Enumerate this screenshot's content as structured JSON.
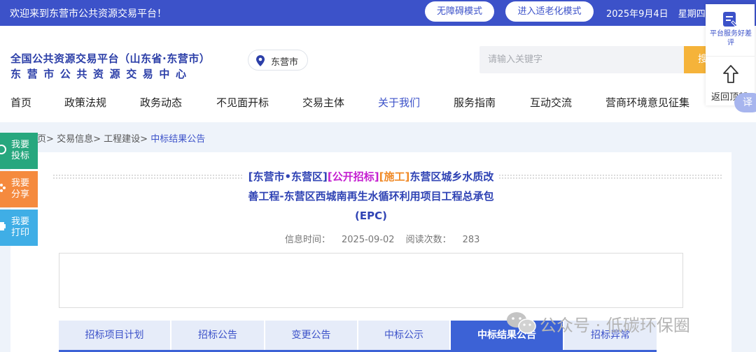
{
  "topbar": {
    "welcome": "欢迎来到东营市公共资源交易平台！",
    "accessible_mode": "无障碍模式",
    "elderly_mode": "进入适老化模式",
    "date": "2025年9月4日",
    "weekday": "星期四"
  },
  "header": {
    "logo_line1": "全国公共资源交易平台（山东省·东营市）",
    "logo_line2": "东营市公共资源交易中心",
    "location": "东营市",
    "search_placeholder": "请输入关键字",
    "search_button": "搜索"
  },
  "nav": {
    "items": [
      "首页",
      "政策法规",
      "政务动态",
      "不见面开标",
      "交易主体",
      "关于我们",
      "服务指南",
      "互动交流",
      "营商环境意见征集"
    ]
  },
  "right_panel": {
    "feedback": "平台服务好差评",
    "back_to_top": "返回顶部",
    "translate": "译"
  },
  "breadcrumb": {
    "home": "首页",
    "level1": "交易信息",
    "level2": "工程建设",
    "current": "中标结果公告",
    "separator": ">"
  },
  "float_buttons": {
    "bid": "我要投标",
    "share": "我要分享",
    "print": "我要打印"
  },
  "article": {
    "tag_region": "[东营市•东营区]",
    "tag_type": "[公开招标]",
    "tag_category": "[施工]",
    "title_rest": "东营区城乡水质改善工程-东营区西城南再生水循环利用项目工程总承包(EPC)",
    "info_time_label": "信息时间：",
    "info_time": "2025-09-02",
    "views_label": "阅读次数：",
    "views": "283"
  },
  "tabs": {
    "items": [
      "招标项目计划",
      "招标公告",
      "变更公告",
      "中标公示",
      "中标结果公告",
      "招标异常"
    ],
    "active_index": 4
  },
  "watermark": {
    "text": "公众号 · 低碳环保圈"
  },
  "colors": {
    "primary": "#3c52c9",
    "accent_orange": "#f5b33a",
    "tag_purple": "#c41fd0",
    "tag_orange": "#f08a27",
    "bid_green": "#27a77e",
    "share_orange": "#f58a3e",
    "print_blue": "#3faee6"
  }
}
